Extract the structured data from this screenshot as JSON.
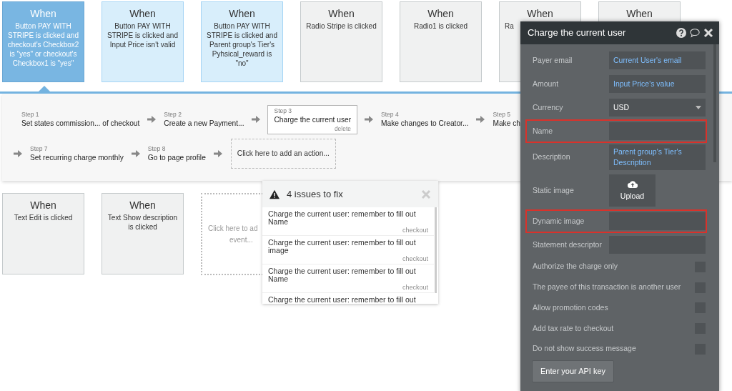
{
  "event_cards": [
    {
      "title": "When",
      "text": "Button PAY WITH STRIPE is clicked and checkout's Checkbox2 is \"yes\" or checkout's Checkbox1 is \"yes\"",
      "selected": true,
      "color": "#79b6e2"
    },
    {
      "title": "When",
      "text": "Button PAY WITH STRIPE is clicked and Input Price isn't valid",
      "selected": false,
      "color": "#d8eefb"
    },
    {
      "title": "When",
      "text": "Button PAY WITH STRIPE is clicked and Parent group's Tier's Pyhsical_reward is \"no\"",
      "selected": false,
      "color": "#d8eefb"
    },
    {
      "title": "When",
      "text": "Radio Stripe is clicked",
      "selected": false,
      "color": "#f0f1f1"
    },
    {
      "title": "When",
      "text": "Radio1 is clicked",
      "selected": false,
      "color": "#f0f1f1"
    },
    {
      "title": "When",
      "text": "Ra",
      "selected": false,
      "color": "#f0f1f1"
    },
    {
      "title": "When",
      "selected": false,
      "color": "#f0f1f1"
    }
  ],
  "action_rows": [
    [
      {
        "label": "Step 1",
        "text": "Set states commission... of checkout",
        "selected": false
      },
      {
        "label": "Step 2",
        "text": "Create a new Payment...",
        "selected": false
      },
      {
        "label": "Step 3",
        "text": "Charge the current user",
        "selected": true,
        "delete": "delete"
      },
      {
        "label": "Step 4",
        "text": "Make changes to Creator...",
        "selected": false
      },
      {
        "label": "Step 5",
        "text": "Make ch",
        "selected": false
      }
    ],
    [
      {
        "label": "Step 7",
        "text": "Set recurring charge monthly",
        "selected": false
      },
      {
        "label": "Step 8",
        "text": "Go to page profile",
        "selected": false
      }
    ]
  ],
  "add_action": "Click here to add an action...",
  "lower_cards": [
    {
      "title": "When",
      "text": "Text Edit is clicked",
      "color": "#f0f1f1"
    },
    {
      "title": "When",
      "text": "Text Show description is clicked",
      "color": "#f0f1f1"
    }
  ],
  "add_event_lines": [
    "Click here to ad",
    "event..."
  ],
  "issues": {
    "title": "4 issues to fix",
    "items": [
      {
        "text": "Charge the current user: remember to fill out Name",
        "page": "checkout"
      },
      {
        "text": "Charge the current user: remember to fill out image",
        "page": "checkout"
      },
      {
        "text": "Charge the current user: remember to fill out Name",
        "page": "checkout"
      },
      {
        "text": "Charge the current user: remember to fill out"
      }
    ]
  },
  "panel": {
    "title": "Charge the current user",
    "rows": [
      {
        "kind": "text",
        "label": "Payer email",
        "value": "Current User's email",
        "highlighted": false
      },
      {
        "kind": "text",
        "label": "Amount",
        "value": "Input Price's value",
        "highlighted": false
      },
      {
        "kind": "dropdown",
        "label": "Currency",
        "value": "USD",
        "highlighted": false
      },
      {
        "kind": "text",
        "label": "Name",
        "highlighted": true
      },
      {
        "kind": "text",
        "label": "Description",
        "value": "Parent group's Tier's Description",
        "highlighted": false
      },
      {
        "kind": "upload",
        "label": "Static image",
        "value": "Upload",
        "highlighted": false
      },
      {
        "kind": "text",
        "label": "Dynamic image",
        "highlighted": true
      },
      {
        "kind": "text",
        "label": "Statement descriptor",
        "highlighted": false
      },
      {
        "kind": "checkbox",
        "label": "Authorize the charge only",
        "checked": false
      },
      {
        "kind": "checkbox",
        "label": "The payee of this transaction is another user",
        "checked": false
      },
      {
        "kind": "checkbox",
        "label": "Allow promotion codes",
        "checked": false
      },
      {
        "kind": "checkbox",
        "label": "Add tax rate to checkout",
        "checked": false
      },
      {
        "kind": "checkbox",
        "label": "Do not show success message",
        "checked": false
      }
    ],
    "button": "Enter your API key"
  }
}
